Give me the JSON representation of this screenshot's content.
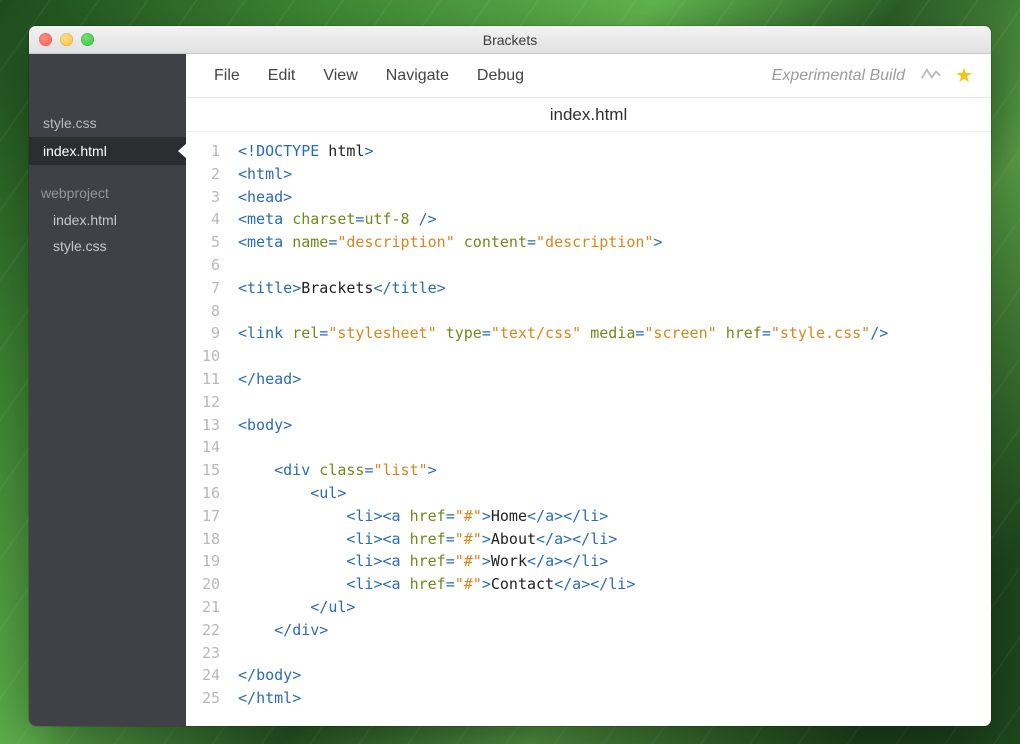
{
  "window": {
    "title": "Brackets"
  },
  "menu": {
    "items": [
      "File",
      "Edit",
      "View",
      "Navigate",
      "Debug"
    ]
  },
  "header": {
    "experimental": "Experimental Build",
    "current_file": "index.html"
  },
  "sidebar": {
    "working_files": [
      {
        "name": "style.css",
        "active": false
      },
      {
        "name": "index.html",
        "active": true
      }
    ],
    "project_name": "webproject",
    "project_files": [
      "index.html",
      "style.css"
    ]
  },
  "editor": {
    "lines": [
      [
        {
          "t": "punct",
          "v": "<!"
        },
        {
          "t": "tag",
          "v": "DOCTYPE"
        },
        {
          "t": "text",
          "v": " html"
        },
        {
          "t": "punct",
          "v": ">"
        }
      ],
      [
        {
          "t": "punct",
          "v": "<"
        },
        {
          "t": "tag",
          "v": "html"
        },
        {
          "t": "punct",
          "v": ">"
        }
      ],
      [
        {
          "t": "punct",
          "v": "<"
        },
        {
          "t": "tag",
          "v": "head"
        },
        {
          "t": "punct",
          "v": ">"
        }
      ],
      [
        {
          "t": "punct",
          "v": "<"
        },
        {
          "t": "tag",
          "v": "meta"
        },
        {
          "t": "text",
          "v": " "
        },
        {
          "t": "attr",
          "v": "charset"
        },
        {
          "t": "punct",
          "v": "="
        },
        {
          "t": "attr",
          "v": "utf-8"
        },
        {
          "t": "text",
          "v": " "
        },
        {
          "t": "punct",
          "v": "/>"
        }
      ],
      [
        {
          "t": "punct",
          "v": "<"
        },
        {
          "t": "tag",
          "v": "meta"
        },
        {
          "t": "text",
          "v": " "
        },
        {
          "t": "attr",
          "v": "name"
        },
        {
          "t": "punct",
          "v": "="
        },
        {
          "t": "str",
          "v": "\"description\""
        },
        {
          "t": "text",
          "v": " "
        },
        {
          "t": "attr",
          "v": "content"
        },
        {
          "t": "punct",
          "v": "="
        },
        {
          "t": "str",
          "v": "\"description\""
        },
        {
          "t": "punct",
          "v": ">"
        }
      ],
      [],
      [
        {
          "t": "punct",
          "v": "<"
        },
        {
          "t": "tag",
          "v": "title"
        },
        {
          "t": "punct",
          "v": ">"
        },
        {
          "t": "text",
          "v": "Brackets"
        },
        {
          "t": "punct",
          "v": "</"
        },
        {
          "t": "tag",
          "v": "title"
        },
        {
          "t": "punct",
          "v": ">"
        }
      ],
      [],
      [
        {
          "t": "punct",
          "v": "<"
        },
        {
          "t": "tag",
          "v": "link"
        },
        {
          "t": "text",
          "v": " "
        },
        {
          "t": "attr",
          "v": "rel"
        },
        {
          "t": "punct",
          "v": "="
        },
        {
          "t": "str",
          "v": "\"stylesheet\""
        },
        {
          "t": "text",
          "v": " "
        },
        {
          "t": "attr",
          "v": "type"
        },
        {
          "t": "punct",
          "v": "="
        },
        {
          "t": "str",
          "v": "\"text/css\""
        },
        {
          "t": "text",
          "v": " "
        },
        {
          "t": "attr",
          "v": "media"
        },
        {
          "t": "punct",
          "v": "="
        },
        {
          "t": "str",
          "v": "\"screen\""
        },
        {
          "t": "text",
          "v": " "
        },
        {
          "t": "attr",
          "v": "href"
        },
        {
          "t": "punct",
          "v": "="
        },
        {
          "t": "str",
          "v": "\"style.css\""
        },
        {
          "t": "punct",
          "v": "/>"
        }
      ],
      [],
      [
        {
          "t": "punct",
          "v": "</"
        },
        {
          "t": "tag",
          "v": "head"
        },
        {
          "t": "punct",
          "v": ">"
        }
      ],
      [],
      [
        {
          "t": "punct",
          "v": "<"
        },
        {
          "t": "tag",
          "v": "body"
        },
        {
          "t": "punct",
          "v": ">"
        }
      ],
      [],
      [
        {
          "t": "text",
          "v": "    "
        },
        {
          "t": "punct",
          "v": "<"
        },
        {
          "t": "tag",
          "v": "div"
        },
        {
          "t": "text",
          "v": " "
        },
        {
          "t": "attr",
          "v": "class"
        },
        {
          "t": "punct",
          "v": "="
        },
        {
          "t": "str",
          "v": "\"list\""
        },
        {
          "t": "punct",
          "v": ">"
        }
      ],
      [
        {
          "t": "text",
          "v": "        "
        },
        {
          "t": "punct",
          "v": "<"
        },
        {
          "t": "tag",
          "v": "ul"
        },
        {
          "t": "punct",
          "v": ">"
        }
      ],
      [
        {
          "t": "text",
          "v": "            "
        },
        {
          "t": "punct",
          "v": "<"
        },
        {
          "t": "tag",
          "v": "li"
        },
        {
          "t": "punct",
          "v": "><"
        },
        {
          "t": "tag",
          "v": "a"
        },
        {
          "t": "text",
          "v": " "
        },
        {
          "t": "attr",
          "v": "href"
        },
        {
          "t": "punct",
          "v": "="
        },
        {
          "t": "str",
          "v": "\"#\""
        },
        {
          "t": "punct",
          "v": ">"
        },
        {
          "t": "text",
          "v": "Home"
        },
        {
          "t": "punct",
          "v": "</"
        },
        {
          "t": "tag",
          "v": "a"
        },
        {
          "t": "punct",
          "v": "></"
        },
        {
          "t": "tag",
          "v": "li"
        },
        {
          "t": "punct",
          "v": ">"
        }
      ],
      [
        {
          "t": "text",
          "v": "            "
        },
        {
          "t": "punct",
          "v": "<"
        },
        {
          "t": "tag",
          "v": "li"
        },
        {
          "t": "punct",
          "v": "><"
        },
        {
          "t": "tag",
          "v": "a"
        },
        {
          "t": "text",
          "v": " "
        },
        {
          "t": "attr",
          "v": "href"
        },
        {
          "t": "punct",
          "v": "="
        },
        {
          "t": "str",
          "v": "\"#\""
        },
        {
          "t": "punct",
          "v": ">"
        },
        {
          "t": "text",
          "v": "About"
        },
        {
          "t": "punct",
          "v": "</"
        },
        {
          "t": "tag",
          "v": "a"
        },
        {
          "t": "punct",
          "v": "></"
        },
        {
          "t": "tag",
          "v": "li"
        },
        {
          "t": "punct",
          "v": ">"
        }
      ],
      [
        {
          "t": "text",
          "v": "            "
        },
        {
          "t": "punct",
          "v": "<"
        },
        {
          "t": "tag",
          "v": "li"
        },
        {
          "t": "punct",
          "v": "><"
        },
        {
          "t": "tag",
          "v": "a"
        },
        {
          "t": "text",
          "v": " "
        },
        {
          "t": "attr",
          "v": "href"
        },
        {
          "t": "punct",
          "v": "="
        },
        {
          "t": "str",
          "v": "\"#\""
        },
        {
          "t": "punct",
          "v": ">"
        },
        {
          "t": "text",
          "v": "Work"
        },
        {
          "t": "punct",
          "v": "</"
        },
        {
          "t": "tag",
          "v": "a"
        },
        {
          "t": "punct",
          "v": "></"
        },
        {
          "t": "tag",
          "v": "li"
        },
        {
          "t": "punct",
          "v": ">"
        }
      ],
      [
        {
          "t": "text",
          "v": "            "
        },
        {
          "t": "punct",
          "v": "<"
        },
        {
          "t": "tag",
          "v": "li"
        },
        {
          "t": "punct",
          "v": "><"
        },
        {
          "t": "tag",
          "v": "a"
        },
        {
          "t": "text",
          "v": " "
        },
        {
          "t": "attr",
          "v": "href"
        },
        {
          "t": "punct",
          "v": "="
        },
        {
          "t": "str",
          "v": "\"#\""
        },
        {
          "t": "punct",
          "v": ">"
        },
        {
          "t": "text",
          "v": "Contact"
        },
        {
          "t": "punct",
          "v": "</"
        },
        {
          "t": "tag",
          "v": "a"
        },
        {
          "t": "punct",
          "v": "></"
        },
        {
          "t": "tag",
          "v": "li"
        },
        {
          "t": "punct",
          "v": ">"
        }
      ],
      [
        {
          "t": "text",
          "v": "        "
        },
        {
          "t": "punct",
          "v": "</"
        },
        {
          "t": "tag",
          "v": "ul"
        },
        {
          "t": "punct",
          "v": ">"
        }
      ],
      [
        {
          "t": "text",
          "v": "    "
        },
        {
          "t": "punct",
          "v": "</"
        },
        {
          "t": "tag",
          "v": "div"
        },
        {
          "t": "punct",
          "v": ">"
        }
      ],
      [],
      [
        {
          "t": "punct",
          "v": "</"
        },
        {
          "t": "tag",
          "v": "body"
        },
        {
          "t": "punct",
          "v": ">"
        }
      ],
      [
        {
          "t": "punct",
          "v": "</"
        },
        {
          "t": "tag",
          "v": "html"
        },
        {
          "t": "punct",
          "v": ">"
        }
      ]
    ]
  }
}
